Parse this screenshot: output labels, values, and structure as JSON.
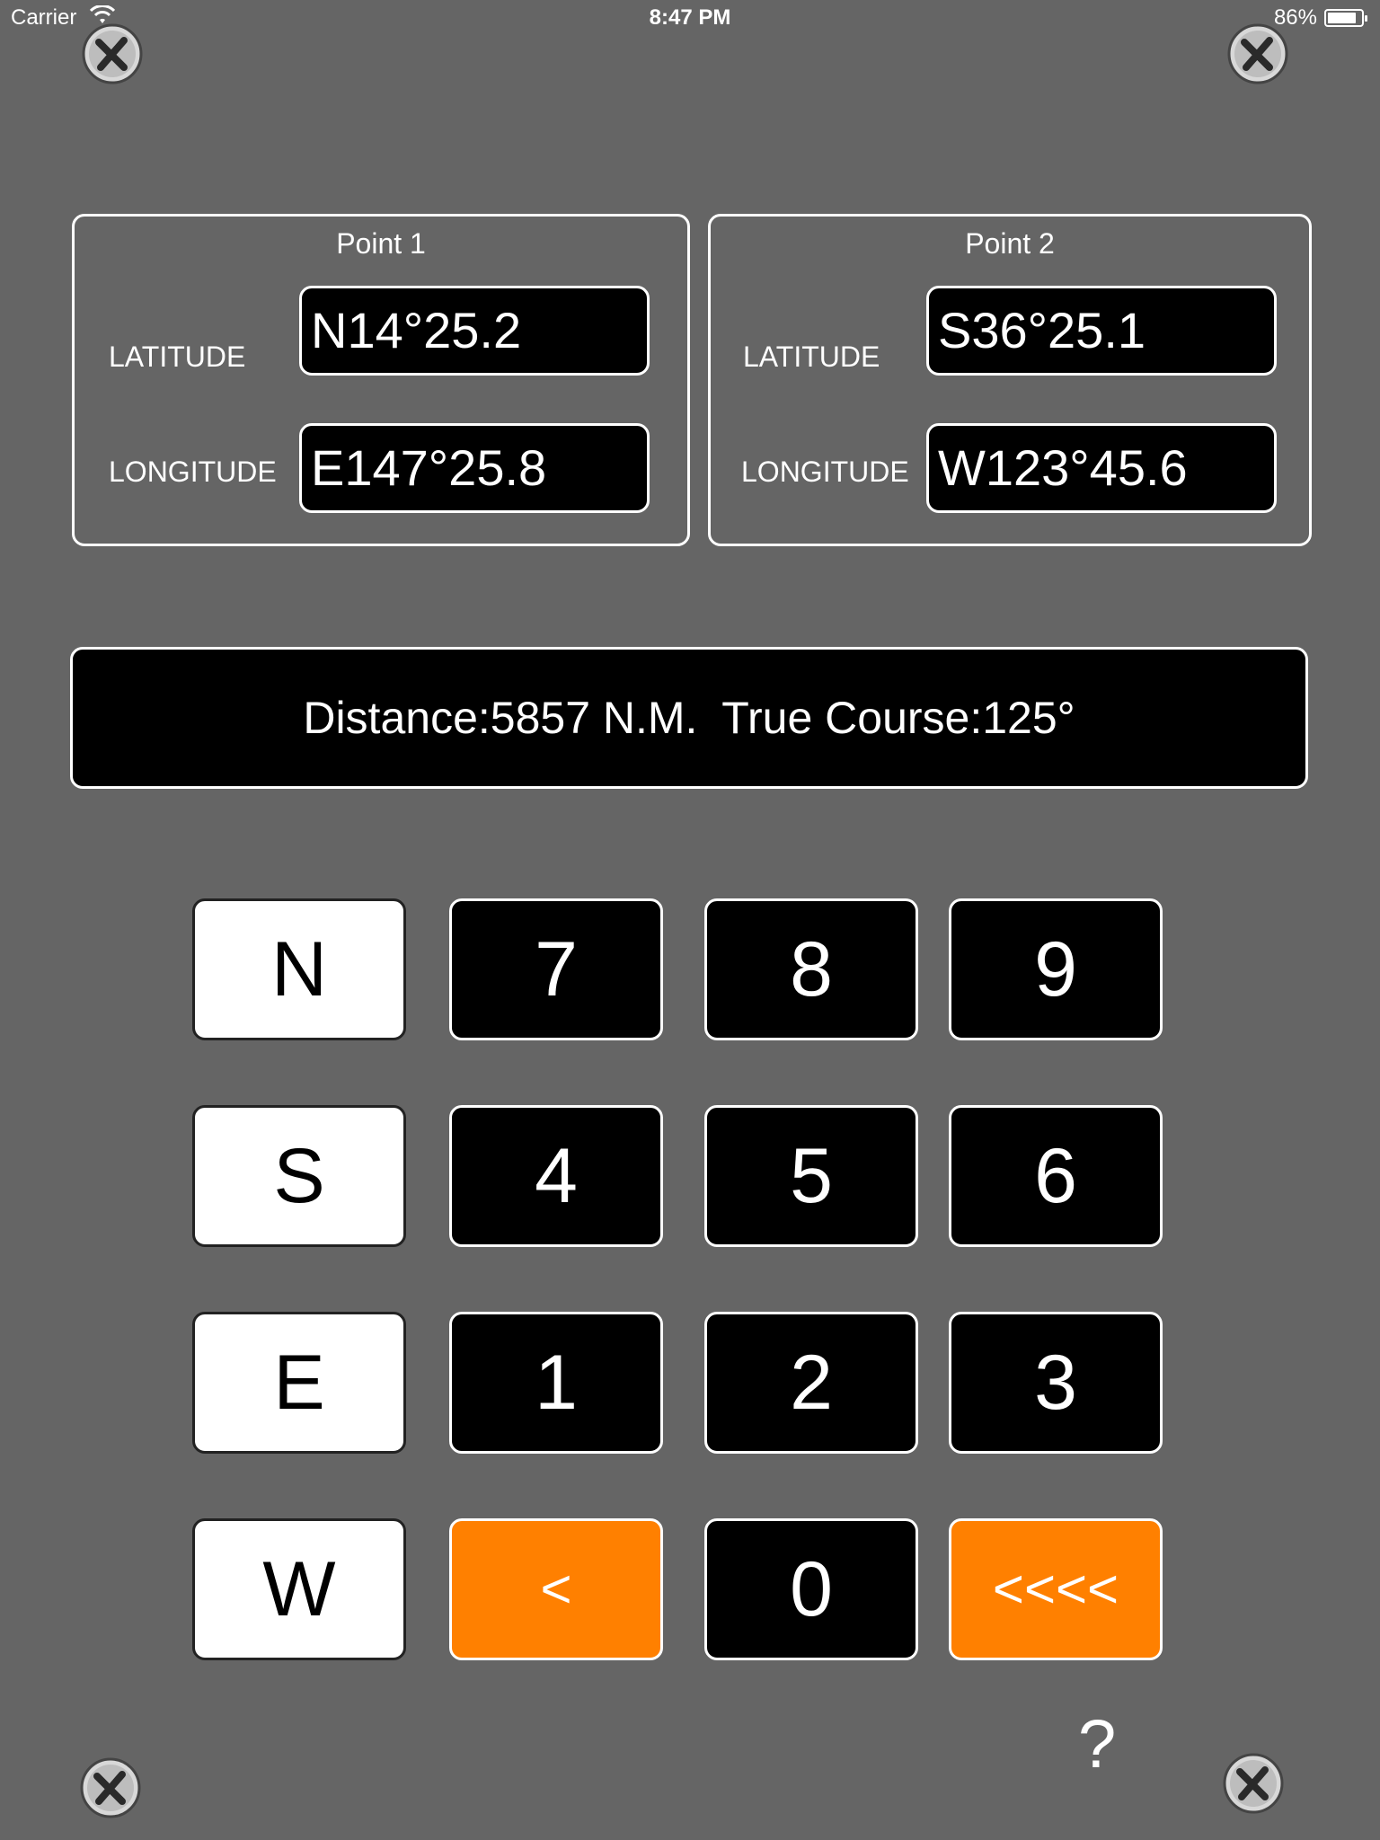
{
  "status": {
    "carrier": "Carrier",
    "time": "8:47 PM",
    "battery": "86%",
    "battery_level": 0.86
  },
  "point1": {
    "title": "Point 1",
    "lat_label": "LATITUDE",
    "lon_label": "LONGITUDE",
    "lat": "N14°25.2",
    "lon": "E147°25.8"
  },
  "point2": {
    "title": "Point 2",
    "lat_label": "LATITUDE",
    "lon_label": "LONGITUDE",
    "lat": "S36°25.1",
    "lon": "W123°45.6"
  },
  "result": {
    "text": "Distance:5857 N.M.  True Course:125°"
  },
  "keys": {
    "n": "N",
    "s": "S",
    "e": "E",
    "w": "W",
    "k7": "7",
    "k8": "8",
    "k9": "9",
    "k4": "4",
    "k5": "5",
    "k6": "6",
    "k1": "1",
    "k2": "2",
    "k3": "3",
    "back": "<",
    "k0": "0",
    "clear": "<<<<"
  },
  "help": "?",
  "colors": {
    "background": "#656565",
    "accent": "#ff8000"
  }
}
